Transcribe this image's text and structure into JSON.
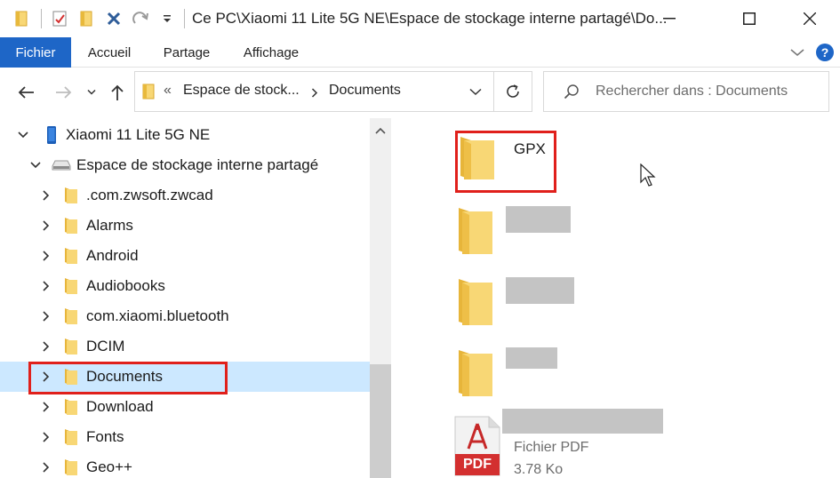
{
  "window": {
    "title": "Ce PC\\Xiaomi 11 Lite 5G NE\\Espace de stockage interne partagé\\Do..."
  },
  "ribbon": {
    "tabs": [
      {
        "label": "Fichier",
        "active": true
      },
      {
        "label": "Accueil",
        "active": false
      },
      {
        "label": "Partage",
        "active": false
      },
      {
        "label": "Affichage",
        "active": false
      }
    ]
  },
  "address": {
    "overflow": "«",
    "crumbs": [
      "Espace de stock...",
      "Documents"
    ]
  },
  "search": {
    "placeholder": "Rechercher dans : Documents"
  },
  "tree": {
    "device": "Xiaomi 11 Lite 5G NE",
    "storage": "Espace de stockage interne partagé",
    "folders": [
      ".com.zwsoft.zwcad",
      "Alarms",
      "Android",
      "Audiobooks",
      "com.xiaomi.bluetooth",
      "DCIM",
      "Documents",
      "Download",
      "Fonts",
      "Geo++"
    ],
    "selected": "Documents"
  },
  "content": {
    "items": [
      {
        "name": "GPX",
        "type": "folder"
      },
      {
        "name": "",
        "type": "folder"
      },
      {
        "name": "",
        "type": "folder"
      },
      {
        "name": "",
        "type": "folder"
      },
      {
        "name": "",
        "type": "pdf",
        "kind": "Fichier PDF",
        "size": "3.78 Ko",
        "badge": "PDF"
      }
    ]
  },
  "colors": {
    "accent": "#1e66c7",
    "selection": "#cce8ff",
    "highlight": "#e0201b",
    "folder": "#f8d775",
    "pdf": "#d32f2f"
  }
}
